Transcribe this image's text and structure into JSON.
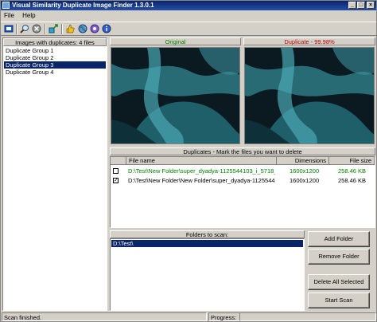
{
  "window": {
    "title": "Visual Similarity Duplicate Image Finder 1.3.0.1"
  },
  "menu": [
    "File",
    "Help"
  ],
  "toolbar_icons": [
    "open-project-icon",
    "search-icon",
    "stop-icon",
    "move-files-icon",
    "thumb-up-icon",
    "web-icon",
    "help-icon",
    "info-icon"
  ],
  "groups_panel": {
    "header": "Images with duplicates: 4 files",
    "items": [
      "Duplicate Group 1",
      "Duplicate Group 2",
      "Duplicate Group 3",
      "Duplicate Group 4"
    ],
    "selected_index": 2
  },
  "preview": {
    "original_label": "Original",
    "duplicate_label": "Duplicate - 99.98%",
    "original_color": "#008000",
    "duplicate_color": "#c00000"
  },
  "duplicates": {
    "header": "Duplicates - Mark the files you want to delete",
    "columns": [
      "File name",
      "Dimensions",
      "File size"
    ],
    "rows": [
      {
        "checked": false,
        "file": "D:\\Test\\New Folder\\super_dyadya-1125544103_i_5718_full...",
        "dimensions": "1600x1200",
        "size": "258.46 KB",
        "color": "#008000"
      },
      {
        "checked": true,
        "file": "D:\\Test\\New Folder\\New Folder\\super_dyadya-1125544103...",
        "dimensions": "1600x1200",
        "size": "258.46 KB",
        "color": "#000000"
      }
    ]
  },
  "folders": {
    "header": "Folders to scan:",
    "items": [
      "D:\\Test\\"
    ]
  },
  "buttons": {
    "add_folder": "Add Folder",
    "remove_folder": "Remove Folder",
    "delete_all": "Delete All Selected",
    "start_scan": "Start Scan"
  },
  "status": {
    "text": "Scan finished.",
    "progress_label": "Progress:"
  }
}
